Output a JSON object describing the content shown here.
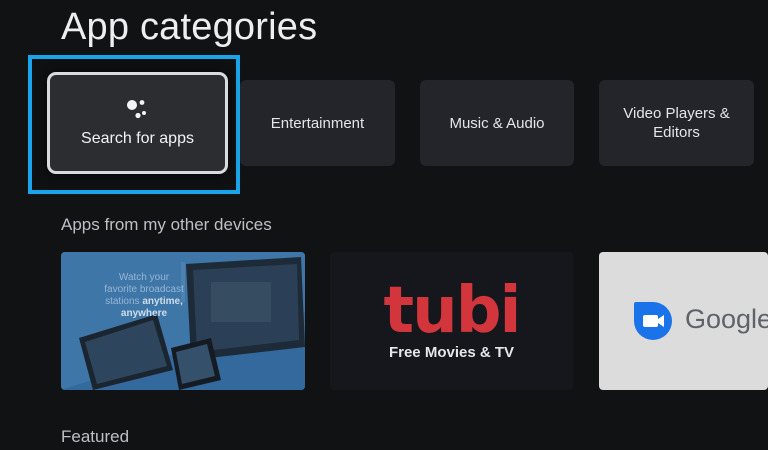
{
  "page": {
    "title": "App categories"
  },
  "categories": [
    {
      "label": "Search for apps",
      "icon": "google-assistant-icon",
      "focused": true
    },
    {
      "label": "Entertainment"
    },
    {
      "label": "Music & Audio"
    },
    {
      "label": "Video Players &\nEditors"
    }
  ],
  "sections": {
    "other_devices": "Apps from my other devices",
    "featured": "Featured"
  },
  "apps": [
    {
      "name": "broadcast-app",
      "text_line1": "Watch your",
      "text_line2": "favorite broadcast",
      "text_line3": "stations",
      "text_emph1": "anytime,",
      "text_emph2": "anywhere"
    },
    {
      "name": "tubi",
      "logo": "tubi",
      "subtitle": "Free Movies & TV"
    },
    {
      "name": "google-duo",
      "icon": "duo-camera-icon",
      "wordmark": "Google"
    }
  ],
  "colors": {
    "background": "#111214",
    "focus": "#1aa3e8",
    "tubi": "#d2353c",
    "duo_blue": "#1a73e8"
  }
}
